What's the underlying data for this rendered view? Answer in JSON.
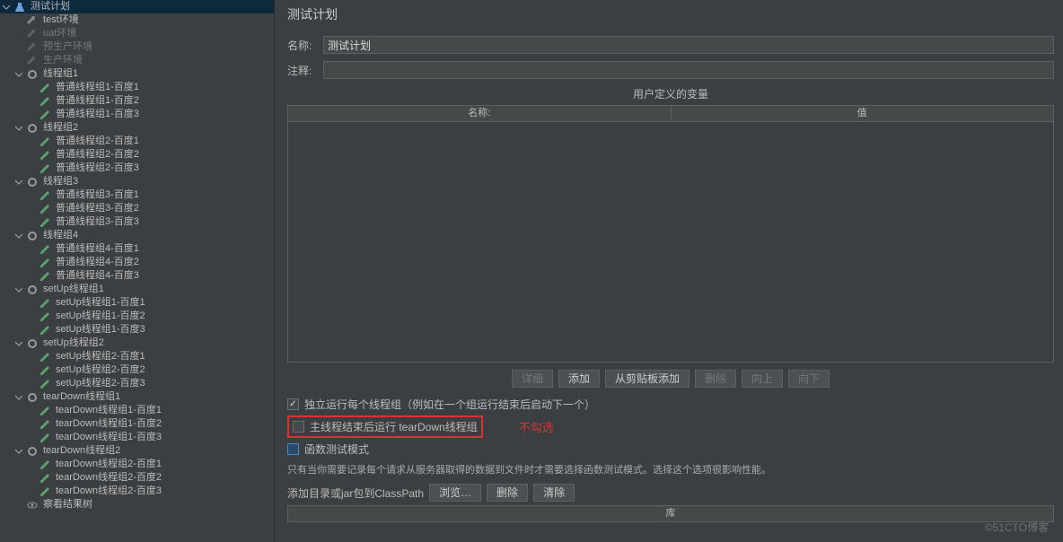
{
  "tree": {
    "root": "测试计划",
    "env": [
      "test环境",
      "uat环境",
      "预生产环境",
      "生产环境"
    ],
    "groups": [
      {
        "name": "线程组1",
        "items": [
          "普通线程组1-百度1",
          "普通线程组1-百度2",
          "普通线程组1-百度3"
        ]
      },
      {
        "name": "线程组2",
        "items": [
          "普通线程组2-百度1",
          "普通线程组2-百度2",
          "普通线程组2-百度3"
        ]
      },
      {
        "name": "线程组3",
        "items": [
          "普通线程组3-百度1",
          "普通线程组3-百度2",
          "普通线程组3-百度3"
        ]
      },
      {
        "name": "线程组4",
        "items": [
          "普通线程组4-百度1",
          "普通线程组4-百度2",
          "普通线程组4-百度3"
        ]
      },
      {
        "name": "setUp线程组1",
        "items": [
          "setUp线程组1-百度1",
          "setUp线程组1-百度2",
          "setUp线程组1-百度3"
        ]
      },
      {
        "name": "setUp线程组2",
        "items": [
          "setUp线程组2-百度1",
          "setUp线程组2-百度2",
          "setUp线程组2-百度3"
        ]
      },
      {
        "name": "tearDown线程组1",
        "items": [
          "tearDown线程组1-百度1",
          "tearDown线程组1-百度2",
          "tearDown线程组1-百度3"
        ]
      },
      {
        "name": "tearDown线程组2",
        "items": [
          "tearDown线程组2-百度1",
          "tearDown线程组2-百度2",
          "tearDown线程组2-百度3"
        ]
      }
    ],
    "result_tree": "察看结果树"
  },
  "panel": {
    "title": "测试计划",
    "name_label": "名称:",
    "name_value": "测试计划",
    "comment_label": "注释:",
    "comment_value": "",
    "vars_title": "用户定义的变量",
    "th_name": "名称:",
    "th_value": "值",
    "buttons": {
      "detail": "详细",
      "add": "添加",
      "paste": "从剪贴板添加",
      "delete": "删除",
      "up": "向上",
      "down": "向下"
    },
    "chk1": "独立运行每个线程组（例如在一个组运行结束后启动下一个）",
    "chk2": "主线程结束后运行 tearDown线程组",
    "annot": "不勾选",
    "chk3": "函数测试模式",
    "info": "只有当你需要记录每个请求从服务器取得的数据到文件时才需要选择函数测试模式。选择这个选项很影响性能。",
    "cp_label": "添加目录或jar包到ClassPath",
    "browse": "浏览…",
    "del": "删除",
    "clear": "清除",
    "lib": "库"
  },
  "watermark": "©51CTO博客"
}
